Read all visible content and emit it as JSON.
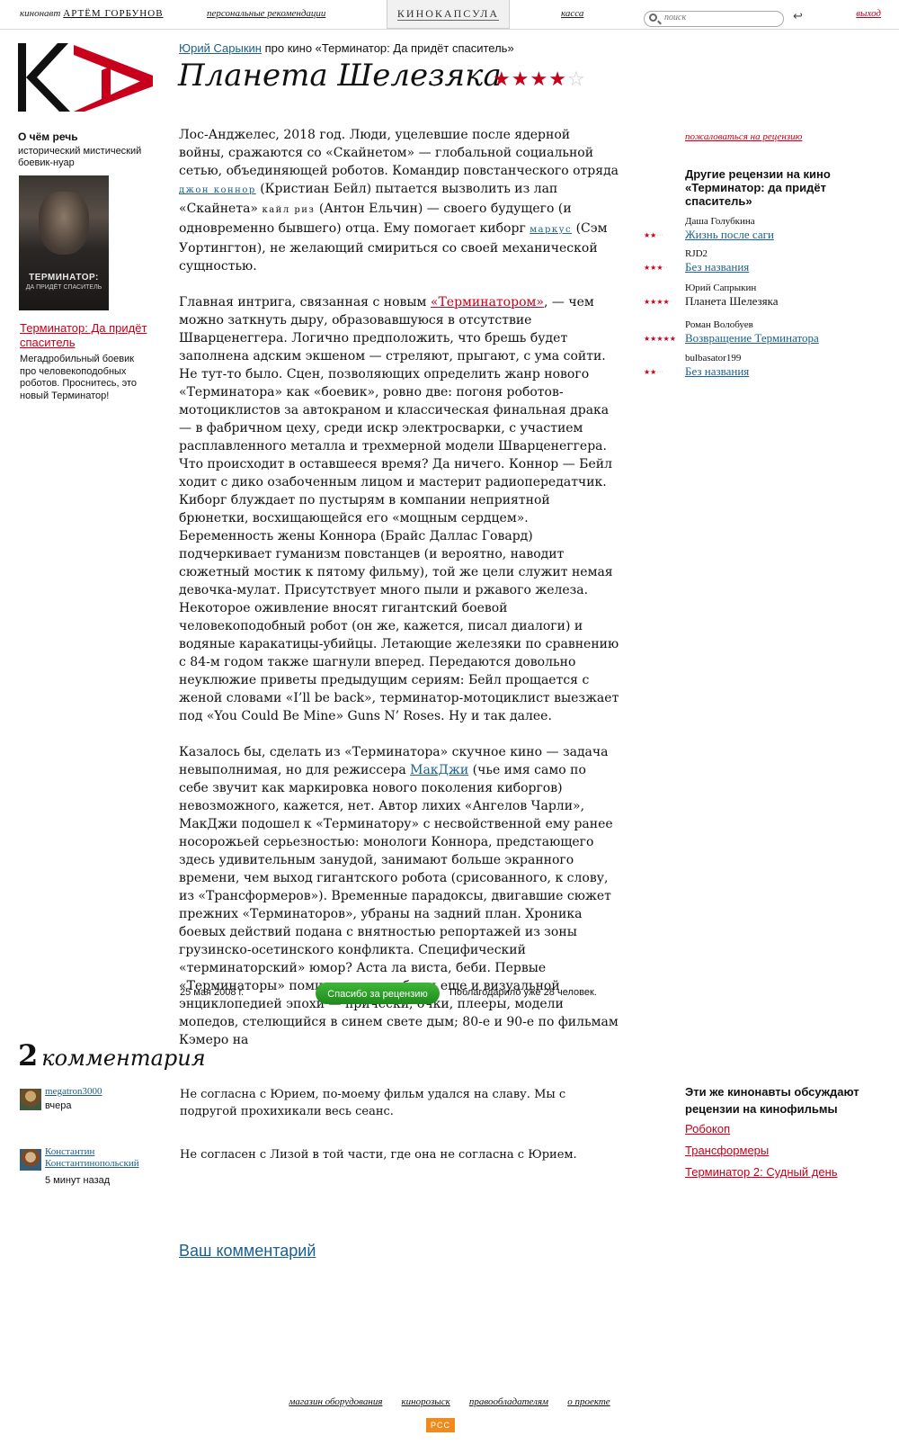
{
  "topbar": {
    "user_label": "кинонавт",
    "user_name": "АРТЁМ ГОРБУНОВ",
    "recommendations": "персональные рекомендации",
    "logo_tab": "КИНОКАПСУЛА",
    "cash": "касса",
    "search_placeholder": "поиск",
    "return_icon": "↩",
    "logout": "выход"
  },
  "sidebar": {
    "about_title": "О чём речь",
    "genre": "исторический мистический боевик-нуар",
    "poster": {
      "title": "ТЕРМИНАТОР:",
      "subtitle": "ДА ПРИДЁТ СПАСИТЕЛЬ"
    },
    "film_link": "Терминатор: Да придёт спаситель",
    "film_desc": "Мегадробильный боевик про человекоподобных роботов. Проснитесь, это новый Терминатор!"
  },
  "review": {
    "author": "Юрий Сарыкин",
    "about_text": "про кино «Терминатор: Да придёт спаситель»",
    "title": "Планета Шелезяка",
    "rating": 4,
    "rating_max": 5,
    "p1": {
      "a": "Лос-Анджелес, 2018 год. Люди, уцелевшие после ядерной войны, сражаются со «Скайнетом» — глобальной социальной сетью, объединяющей роботов. Командир повстанческого отряда ",
      "link1": "джон коннор",
      "b": " (Кристиан Бейл) пытается вызволить из лап «Скайнета» ",
      "name2": "кайл риз",
      "c": " (Антон Ельчин) — своего будущего (и одновременно бывшего) отца. Ему помогает киборг ",
      "link3": "маркус",
      "d": " (Сэм Уортингтон), не желающий смириться со своей механической сущностью."
    },
    "p2": {
      "a": "Главная интрига, связанная с новым ",
      "link": "«Терминатором»",
      "b": ", — чем можно заткнуть дыру, образовавшуюся в отсутствие Шварценеггера. Логично предположить, что брешь будет заполнена адским экшеном — стреляют, прыгают, с ума сойти. Не тут-то было. Сцен, позволяющих определить жанр нового «Терминатора» как «боевик», ровно две: погоня роботов-мотоциклистов за автокраном и классическая финальная драка — в фабричном цеху, среди искр электросварки, с участием расплавленного металла и трехмерной модели Шварценеггера. Что происходит в оставшееся время? Да ничего. Коннор — Бейл ходит с дико озабоченным лицом и мастерит радиопередатчик. Киборг блуждает по пустырям в компании неприятной брюнетки, восхищающейся его «мощным сердцем». Беременность жены Коннора (Брайс Даллас Говард) подчеркивает гуманизм повстанцев (и вероятно, наводит сюжетный мостик к пятому фильму), той же цели служит немая девочка-мулат. Присутствует много пыли и ржавого железа. Некоторое оживление вносят гигантский боевой человекоподобный робот (он же, кажется, писал диалоги) и водяные каракатицы-убийцы. Летающие железяки по сравнению с 84-м годом также шагнули вперед. Передаются довольно неуклюжие приветы предыдущим сериям: Бейл прощается с женой словами «I’ll be back», терминатор-мотоциклист выезжает под «You Could Be Mine» Guns N’ Roses. Ну и так далее."
    },
    "p3": {
      "a": "Казалось бы, сделать из «Терминатора» скучное кино — задача невыполнимая, но для режиссера ",
      "link": "МакДжи",
      "b": " (чье имя само по себе звучит как маркировка нового поколения киборгов) невозможного, кажется, нет. Автор лихих «Ангелов Чарли», МакДжи подошел к «Терминатору» с несвойственной ему ранее носорожьей серьезностью: монологи Коннора, предстающего здесь удивительным занудой, занимают больше экранного времени, чем выход гигантского робота (срисованного, к слову, из «Трансформеров»). Временные парадоксы, двигавшие сюжет прежних «Терминаторов», убраны на задний план. Хроника боевых действий подана с внятностью репортажей из зоны грузинско-осетинского конфликта. Специфический «терминаторский» юмор? Аста ла виста, беби. Первые «Терминаторы» помимо прочего были еще и визуальной энциклопедией эпохи — прически, очки, плееры, модели мопедов, стелющийся в синем свете дым; 80-е и 90-е по фильмам Кэмеро на"
    },
    "date": "25 мая 2008 г.",
    "thanks_button": "Спасибо за рецензию",
    "thanked": "Поблагодарило уже 28 человек."
  },
  "right": {
    "complain": "пожаловаться на рецензию",
    "other_title": "Другие рецензии на кино «Терминатор: да придёт спаситель»",
    "other_reviews": [
      {
        "author": "Даша Голубкина",
        "title": "Жизнь после саги",
        "rating": 2,
        "link": true
      },
      {
        "author": "RJD2",
        "title": "Без названия",
        "rating": 3,
        "link": true
      },
      {
        "author": "Юрий Сапрыкин",
        "title": "Планета Шелезяка",
        "rating": 4,
        "link": false
      },
      {
        "author": "Роман Волобуев",
        "title": "Возвращение Терминатора",
        "rating": 5,
        "link": true
      },
      {
        "author": "bulbasator199",
        "title": "Без названия",
        "rating": 2,
        "link": true
      }
    ]
  },
  "comments": {
    "count": "2",
    "word": "комментария",
    "items": [
      {
        "name": "megatron3000",
        "time": "вчера",
        "text": "Не согласна с Юрием, по-моему фильм удался на славу. Мы с подругой прохихикали весь сеанс."
      },
      {
        "name": "Константин Константинопольский",
        "time": "5 минут назад",
        "text": "Не согласен с Лизой в той части, где она не согласна с Юрием."
      }
    ],
    "your_comment": "Ваш комментарий"
  },
  "same": {
    "title": "Эти же кинонавты обсуждают рецензии на кинофильмы",
    "links": [
      "Робокоп",
      "Трансформеры",
      "Терминатор 2: Судный день"
    ]
  },
  "footer": {
    "links": [
      "магазин оборудования",
      "кинорозыск",
      "правообладателям",
      "о проекте"
    ],
    "rss": "РСС"
  },
  "colors": {
    "accent": "#c8001b",
    "link": "#1a5f8f",
    "button": "#2a9a26",
    "rss": "#ef8a1d"
  },
  "icons": {
    "search": "search-icon",
    "return": "return-icon",
    "star": "star-icon"
  }
}
